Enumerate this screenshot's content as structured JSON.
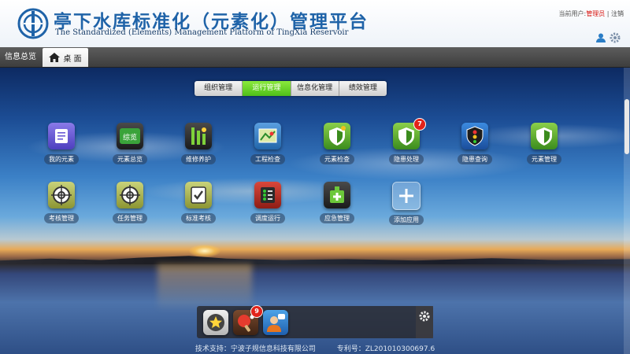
{
  "header": {
    "title_cn": "亭下水库标准化（元素化）管理平台",
    "title_en": "The Standardized (Elements) Management Platform of TingXia Reservoir",
    "user_prefix": "当前用户:",
    "user_name": "管理员",
    "separator": "|",
    "logout": "注销",
    "icons": [
      "user-icon",
      "settings-icon"
    ]
  },
  "tabs": {
    "overview": "信息总览",
    "desktop": "桌 面"
  },
  "category_tabs": [
    {
      "label": "组织管理",
      "active": false
    },
    {
      "label": "运行管理",
      "active": true
    },
    {
      "label": "信息化管理",
      "active": false
    },
    {
      "label": "绩效管理",
      "active": false
    }
  ],
  "apps_row1": [
    {
      "label": "我的元素",
      "icon": "note-icon"
    },
    {
      "label": "元素总览",
      "icon": "overview-icon",
      "icon_text": "综览"
    },
    {
      "label": "维修养护",
      "icon": "maintenance-icon"
    },
    {
      "label": "工程检查",
      "icon": "map-check-icon"
    },
    {
      "label": "元素检查",
      "icon": "shield-icon"
    },
    {
      "label": "隐患处理",
      "icon": "shield-icon",
      "badge": "7"
    },
    {
      "label": "隐患查询",
      "icon": "traffic-light-icon"
    },
    {
      "label": "元素管理",
      "icon": "shield-icon"
    }
  ],
  "apps_row2": [
    {
      "label": "考核管理",
      "icon": "target-icon"
    },
    {
      "label": "任务管理",
      "icon": "target-icon"
    },
    {
      "label": "标准考核",
      "icon": "checklist-icon"
    },
    {
      "label": "调度运行",
      "icon": "dispatch-icon"
    },
    {
      "label": "应急管理",
      "icon": "emergency-icon"
    },
    {
      "label": "添加应用",
      "icon": "plus-icon"
    }
  ],
  "dock": {
    "items": [
      {
        "icon": "star-icon"
      },
      {
        "icon": "ping-pong-icon",
        "badge": "9"
      },
      {
        "icon": "user-chat-icon"
      }
    ],
    "settings_icon": "gear-icon"
  },
  "footer": {
    "support": "技术支持：宁波子规信息科技有限公司",
    "patent": "专利号：ZL201010300697.6"
  }
}
